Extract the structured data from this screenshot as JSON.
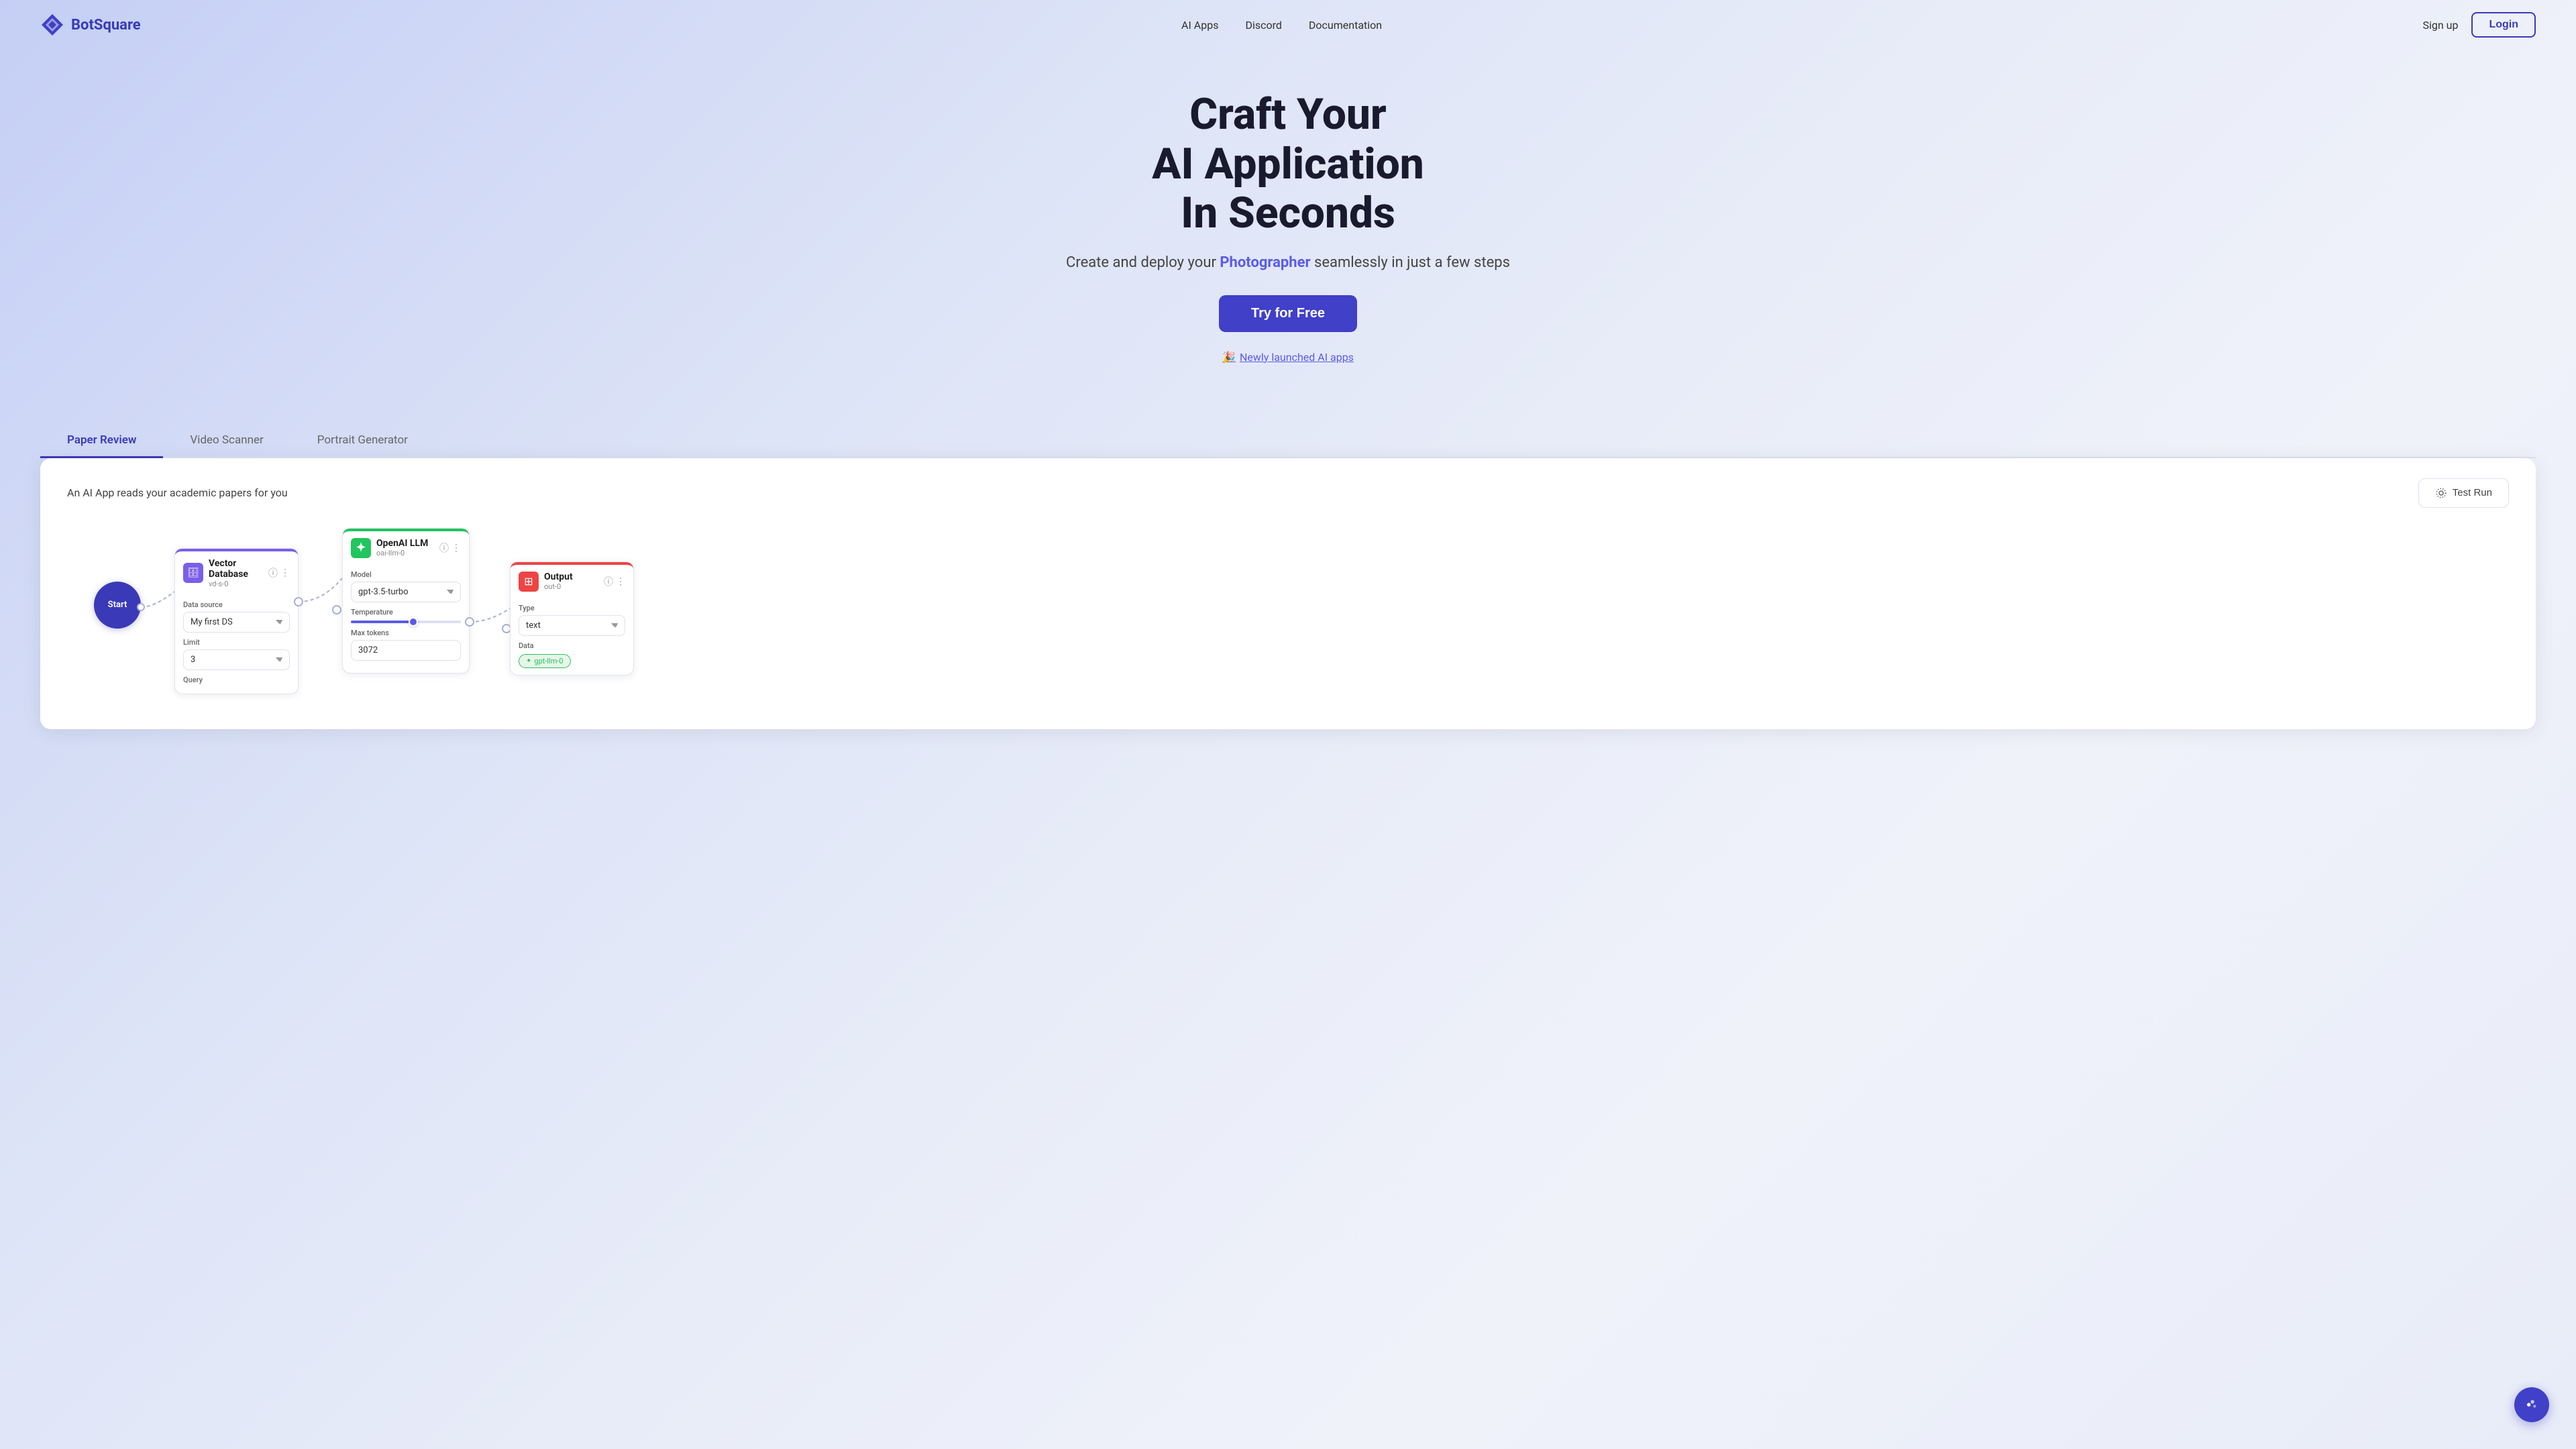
{
  "navbar": {
    "logo_text": "BotSquare",
    "nav_links": [
      {
        "label": "AI Apps",
        "key": "ai-apps"
      },
      {
        "label": "Discord",
        "key": "discord"
      },
      {
        "label": "Documentation",
        "key": "documentation"
      }
    ],
    "signup_label": "Sign up",
    "login_label": "Login"
  },
  "hero": {
    "title_line1": "Craft Your",
    "title_line2": "AI Application",
    "title_line3": "In Seconds",
    "subtitle_before": "Create and deploy your ",
    "subtitle_highlight": "Photographer",
    "subtitle_after": " seamlessly in just a few steps",
    "try_button": "Try for Free",
    "launched_emoji": "🎉",
    "launched_text": "Newly launched AI apps"
  },
  "tabs": [
    {
      "label": "Paper Review",
      "active": true
    },
    {
      "label": "Video Scanner",
      "active": false
    },
    {
      "label": "Portrait Generator",
      "active": false
    }
  ],
  "demo": {
    "description": "An AI App reads your academic papers for you",
    "test_run_label": "Test Run",
    "flow": {
      "start_label": "Start",
      "nodes": [
        {
          "id": "vector-db",
          "title": "Vector Database",
          "subtitle": "vd-s-0",
          "type": "purple",
          "icon": "🗄",
          "fields": [
            {
              "label": "Data source",
              "type": "select",
              "value": "My first DS"
            },
            {
              "label": "Limit",
              "type": "select",
              "value": "3"
            },
            {
              "label": "Query",
              "type": "text-label"
            }
          ]
        },
        {
          "id": "openai-llm",
          "title": "OpenAI LLM",
          "subtitle": "oai-llm-0",
          "type": "green",
          "icon": "✦",
          "fields": [
            {
              "label": "Model",
              "type": "select",
              "value": "gpt-3.5-turbo"
            },
            {
              "label": "Temperature",
              "type": "slider"
            },
            {
              "label": "Max tokens",
              "type": "input",
              "value": "3072"
            }
          ]
        },
        {
          "id": "output",
          "title": "Output",
          "subtitle": "out-0",
          "type": "red",
          "icon": "⊞",
          "fields": [
            {
              "label": "Type",
              "type": "select",
              "value": "text"
            },
            {
              "label": "Data",
              "type": "tag",
              "value": "gpt-llm-0"
            }
          ]
        }
      ]
    }
  }
}
